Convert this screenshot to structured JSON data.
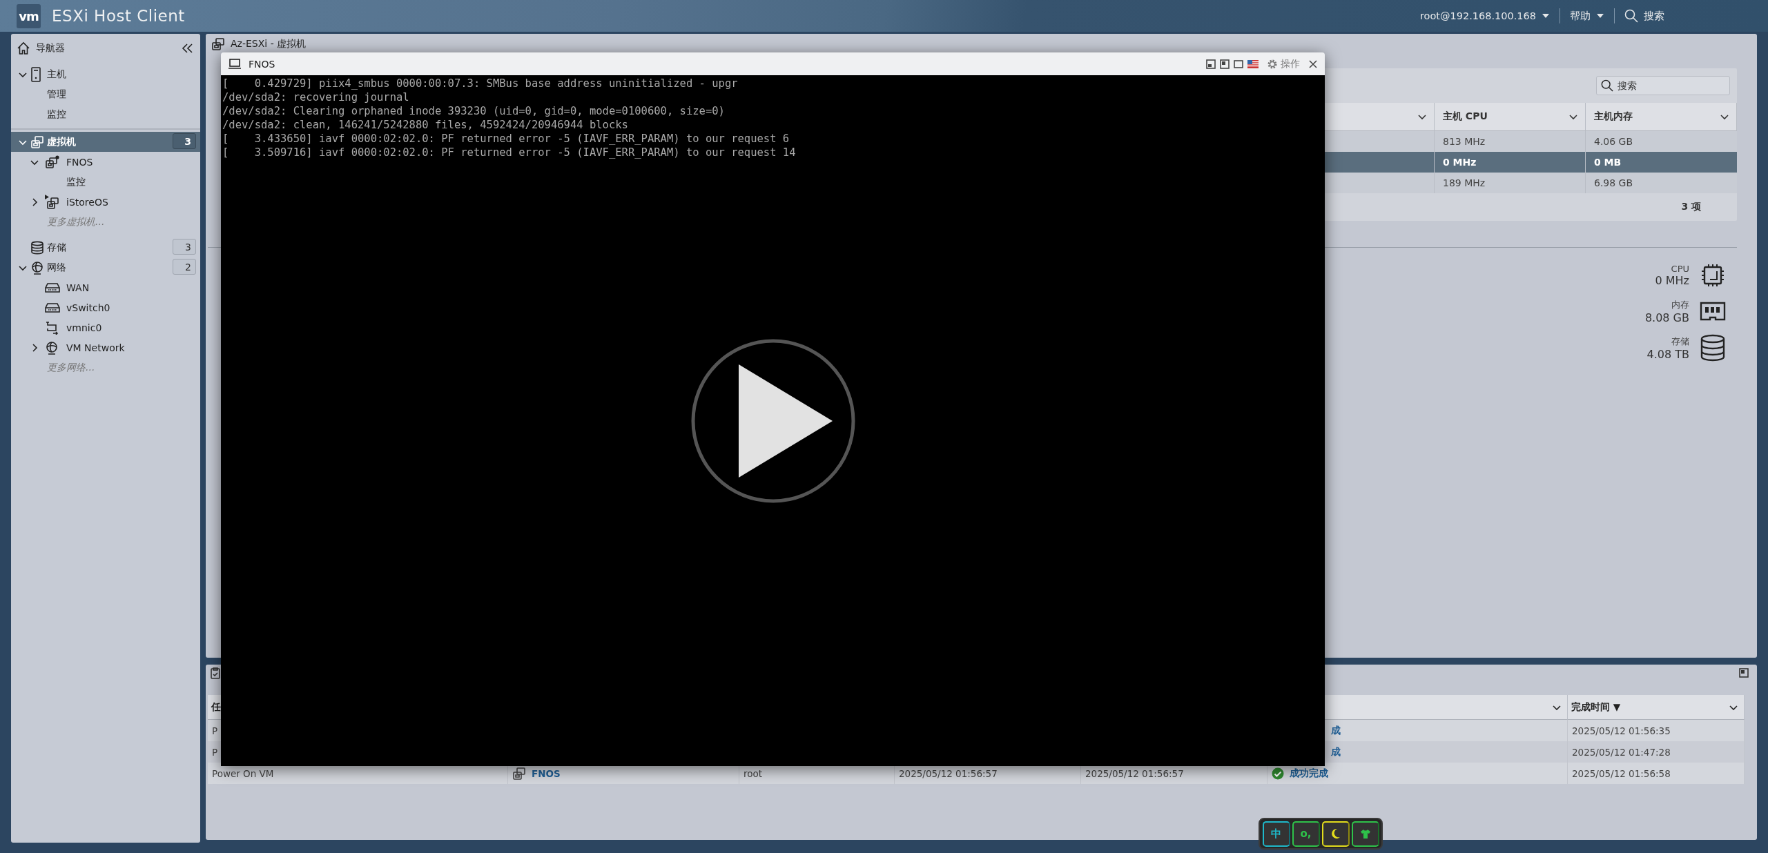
{
  "header": {
    "logo": "vm",
    "title": "ESXi Host Client",
    "user": "root@192.168.100.168",
    "help": "帮助",
    "search": "搜索"
  },
  "navigator": {
    "title": "导航器",
    "items": [
      {
        "kind": "host",
        "label": "主机",
        "expanded": true,
        "selected": false,
        "children": [
          {
            "kind": "link",
            "label": "管理",
            "selected": false
          },
          {
            "kind": "link",
            "label": "监控",
            "selected": false
          }
        ]
      },
      {
        "kind": "vms",
        "label": "虚拟机",
        "count": "3",
        "expanded": true,
        "selected": true,
        "children": [
          {
            "kind": "vm-dot",
            "label": "FNOS",
            "expanded": true,
            "selected": false,
            "children": [
              {
                "kind": "link",
                "label": "监控",
                "selected": false
              }
            ]
          },
          {
            "kind": "vm-play",
            "label": "iStoreOS",
            "expanded": false,
            "selected": false
          },
          {
            "kind": "more",
            "label": "更多虚拟机...",
            "selected": false
          }
        ]
      },
      {
        "kind": "storage",
        "label": "存储",
        "count": "3",
        "selected": false
      },
      {
        "kind": "network",
        "label": "网络",
        "count": "2",
        "expanded": true,
        "selected": false,
        "children": [
          {
            "kind": "switch",
            "label": "WAN",
            "selected": false
          },
          {
            "kind": "switch",
            "label": "vSwitch0",
            "selected": false
          },
          {
            "kind": "nic",
            "label": "vmnic0",
            "selected": false
          },
          {
            "kind": "globe",
            "label": "VM Network",
            "expanded": false,
            "selected": false
          },
          {
            "kind": "more",
            "label": "更多网络...",
            "selected": false
          }
        ]
      }
    ]
  },
  "panel_title": "Az-ESXi - 虚拟机",
  "vm_table": {
    "search_placeholder": "搜索",
    "columns": [
      "主机 CPU",
      "主机内存"
    ],
    "rows": [
      {
        "selected": false,
        "host_cpu": "813 MHz",
        "host_memory": "4.06 GB"
      },
      {
        "selected": true,
        "host_cpu": "0 MHz",
        "host_memory": "0 MB"
      },
      {
        "selected": false,
        "host_cpu": "189 MHz",
        "host_memory": "6.98 GB"
      }
    ],
    "footer": "3 项"
  },
  "resources": [
    {
      "kind": "cpu",
      "label": "CPU",
      "value": "0 MHz"
    },
    {
      "kind": "memory",
      "label": "内存",
      "value": "8.08 GB"
    },
    {
      "kind": "storage",
      "label": "存储",
      "value": "4.08 TB"
    }
  ],
  "tasks": {
    "columns": {
      "task": "任",
      "completed": "完成时间 ▼"
    },
    "rows": [
      {
        "task": "P",
        "result": "成",
        "completed": "2025/05/12 01:56:35"
      },
      {
        "task": "P",
        "result": "成",
        "completed": "2025/05/12 01:47:28"
      },
      {
        "task": "Power On VM",
        "target": "FNOS",
        "initiator": "root",
        "queued": "2025/05/12 01:56:57",
        "started": "2025/05/12 01:56:57",
        "succeeded": true,
        "result": "成功完成",
        "completed": "2025/05/12 01:56:58"
      }
    ]
  },
  "console": {
    "title": "FNOS",
    "actions": "操作",
    "lines": [
      "[    0.429729] piix4_smbus 0000:00:07.3: SMBus base address uninitialized - upgr",
      "/dev/sda2: recovering journal",
      "/dev/sda2: Clearing orphaned inode 393230 (uid=0, gid=0, mode=0100600, size=0)",
      "/dev/sda2: clean, 146241/5242880 files, 4592424/20946944 blocks",
      "[    3.433650] iavf 0000:02:02.0: PF returned error -5 (IAVF_ERR_PARAM) to our request 6",
      "[    3.509716] iavf 0000:02:02.0: PF returned error -5 (IAVF_ERR_PARAM) to our request 14"
    ]
  },
  "ime_bar": {
    "keys": [
      {
        "kind": "text",
        "label": "中",
        "color": "#1fb8c9"
      },
      {
        "kind": "text",
        "label": "o,",
        "color": "#2ec24a"
      },
      {
        "kind": "moon",
        "color": "#e2dc1c"
      },
      {
        "kind": "shirt",
        "color": "#2ec24a"
      }
    ]
  }
}
